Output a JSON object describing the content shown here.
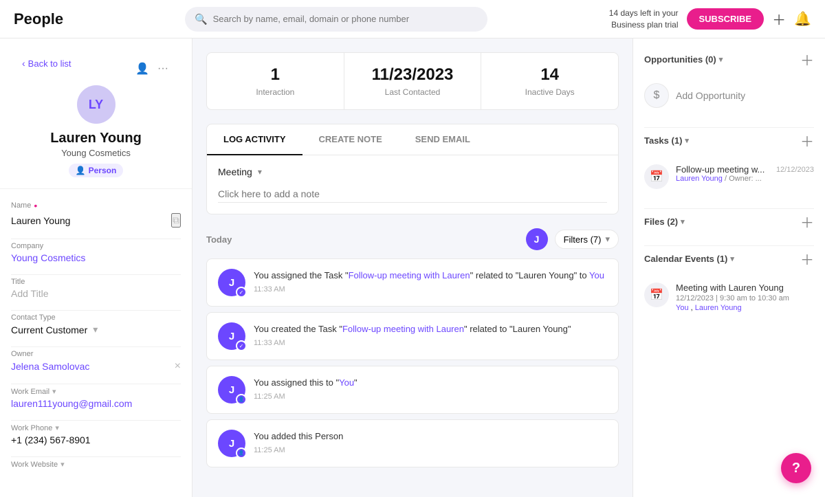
{
  "app": {
    "title": "People"
  },
  "topnav": {
    "search_placeholder": "Search by name, email, domain or phone number",
    "trial_text_1": "14 days left in your",
    "trial_text_2": "Business plan trial",
    "subscribe_label": "SUBSCRIBE"
  },
  "left_panel": {
    "back_label": "Back to list",
    "avatar_initials": "LY",
    "profile_name": "Lauren Young",
    "profile_company": "Young Cosmetics",
    "badge_label": "Person",
    "fields": {
      "name_label": "Name",
      "name_value": "Lauren Young",
      "company_label": "Company",
      "company_value": "Young Cosmetics",
      "title_label": "Title",
      "title_placeholder": "Add Title",
      "contact_type_label": "Contact Type",
      "contact_type_value": "Current Customer",
      "owner_label": "Owner",
      "owner_value": "Jelena Samolovac",
      "work_email_label": "Work Email",
      "work_email_value": "lauren111young@gmail.com",
      "work_phone_label": "Work Phone",
      "work_phone_value": "+1 (234) 567-8901",
      "work_website_label": "Work Website"
    }
  },
  "stats": {
    "interaction_count": "1",
    "interaction_label": "Interaction",
    "last_contacted_value": "11/23/2023",
    "last_contacted_label": "Last Contacted",
    "inactive_days_value": "14",
    "inactive_days_label": "Inactive Days"
  },
  "tabs": {
    "log_activity_label": "LOG ACTIVITY",
    "create_note_label": "CREATE NOTE",
    "send_email_label": "SEND EMAIL",
    "meeting_label": "Meeting",
    "note_placeholder": "Click here to add a note"
  },
  "activity": {
    "date_label": "Today",
    "filter_label": "Filters (7)",
    "j_avatar": "J",
    "items": [
      {
        "avatar_initials": "J",
        "badge": "✓",
        "text_pre": "You assigned the Task \"",
        "link_text": "Follow-up meeting with Lauren",
        "text_mid": "\" related to \"Lauren Young\" to",
        "link_you": "You",
        "text_post": "",
        "time": "11:33 AM"
      },
      {
        "avatar_initials": "J",
        "badge": "✓",
        "text_pre": "You created the Task \"",
        "link_text": "Follow-up meeting with Lauren",
        "text_mid": "\" related to \"Lauren Young\"",
        "link_you": "",
        "text_post": "",
        "time": "11:33 AM"
      },
      {
        "avatar_initials": "J",
        "badge": "👤",
        "text_pre": "You assigned this to \"",
        "link_text": "You",
        "text_mid": "\"",
        "link_you": "",
        "text_post": "",
        "time": "11:25 AM"
      },
      {
        "avatar_initials": "J",
        "badge": "👤",
        "text_pre": "You added this Person",
        "link_text": "",
        "text_mid": "",
        "link_you": "",
        "text_post": "",
        "time": "11:25 AM"
      }
    ]
  },
  "right_panel": {
    "opportunities_label": "Opportunities (0)",
    "add_opportunity_label": "Add Opportunity",
    "tasks_label": "Tasks (1)",
    "task_title": "Follow-up meeting w...",
    "task_date": "12/12/2023",
    "task_person": "Lauren Young",
    "task_owner": "Owner: ...",
    "files_label": "Files (2)",
    "calendar_label": "Calendar Events (1)",
    "cal_event_title": "Meeting with Lauren Young",
    "cal_event_date": "12/12/2023 | 9:30 am to 10:30 am",
    "cal_attendee1": "You",
    "cal_attendee2": "Lauren Young"
  }
}
